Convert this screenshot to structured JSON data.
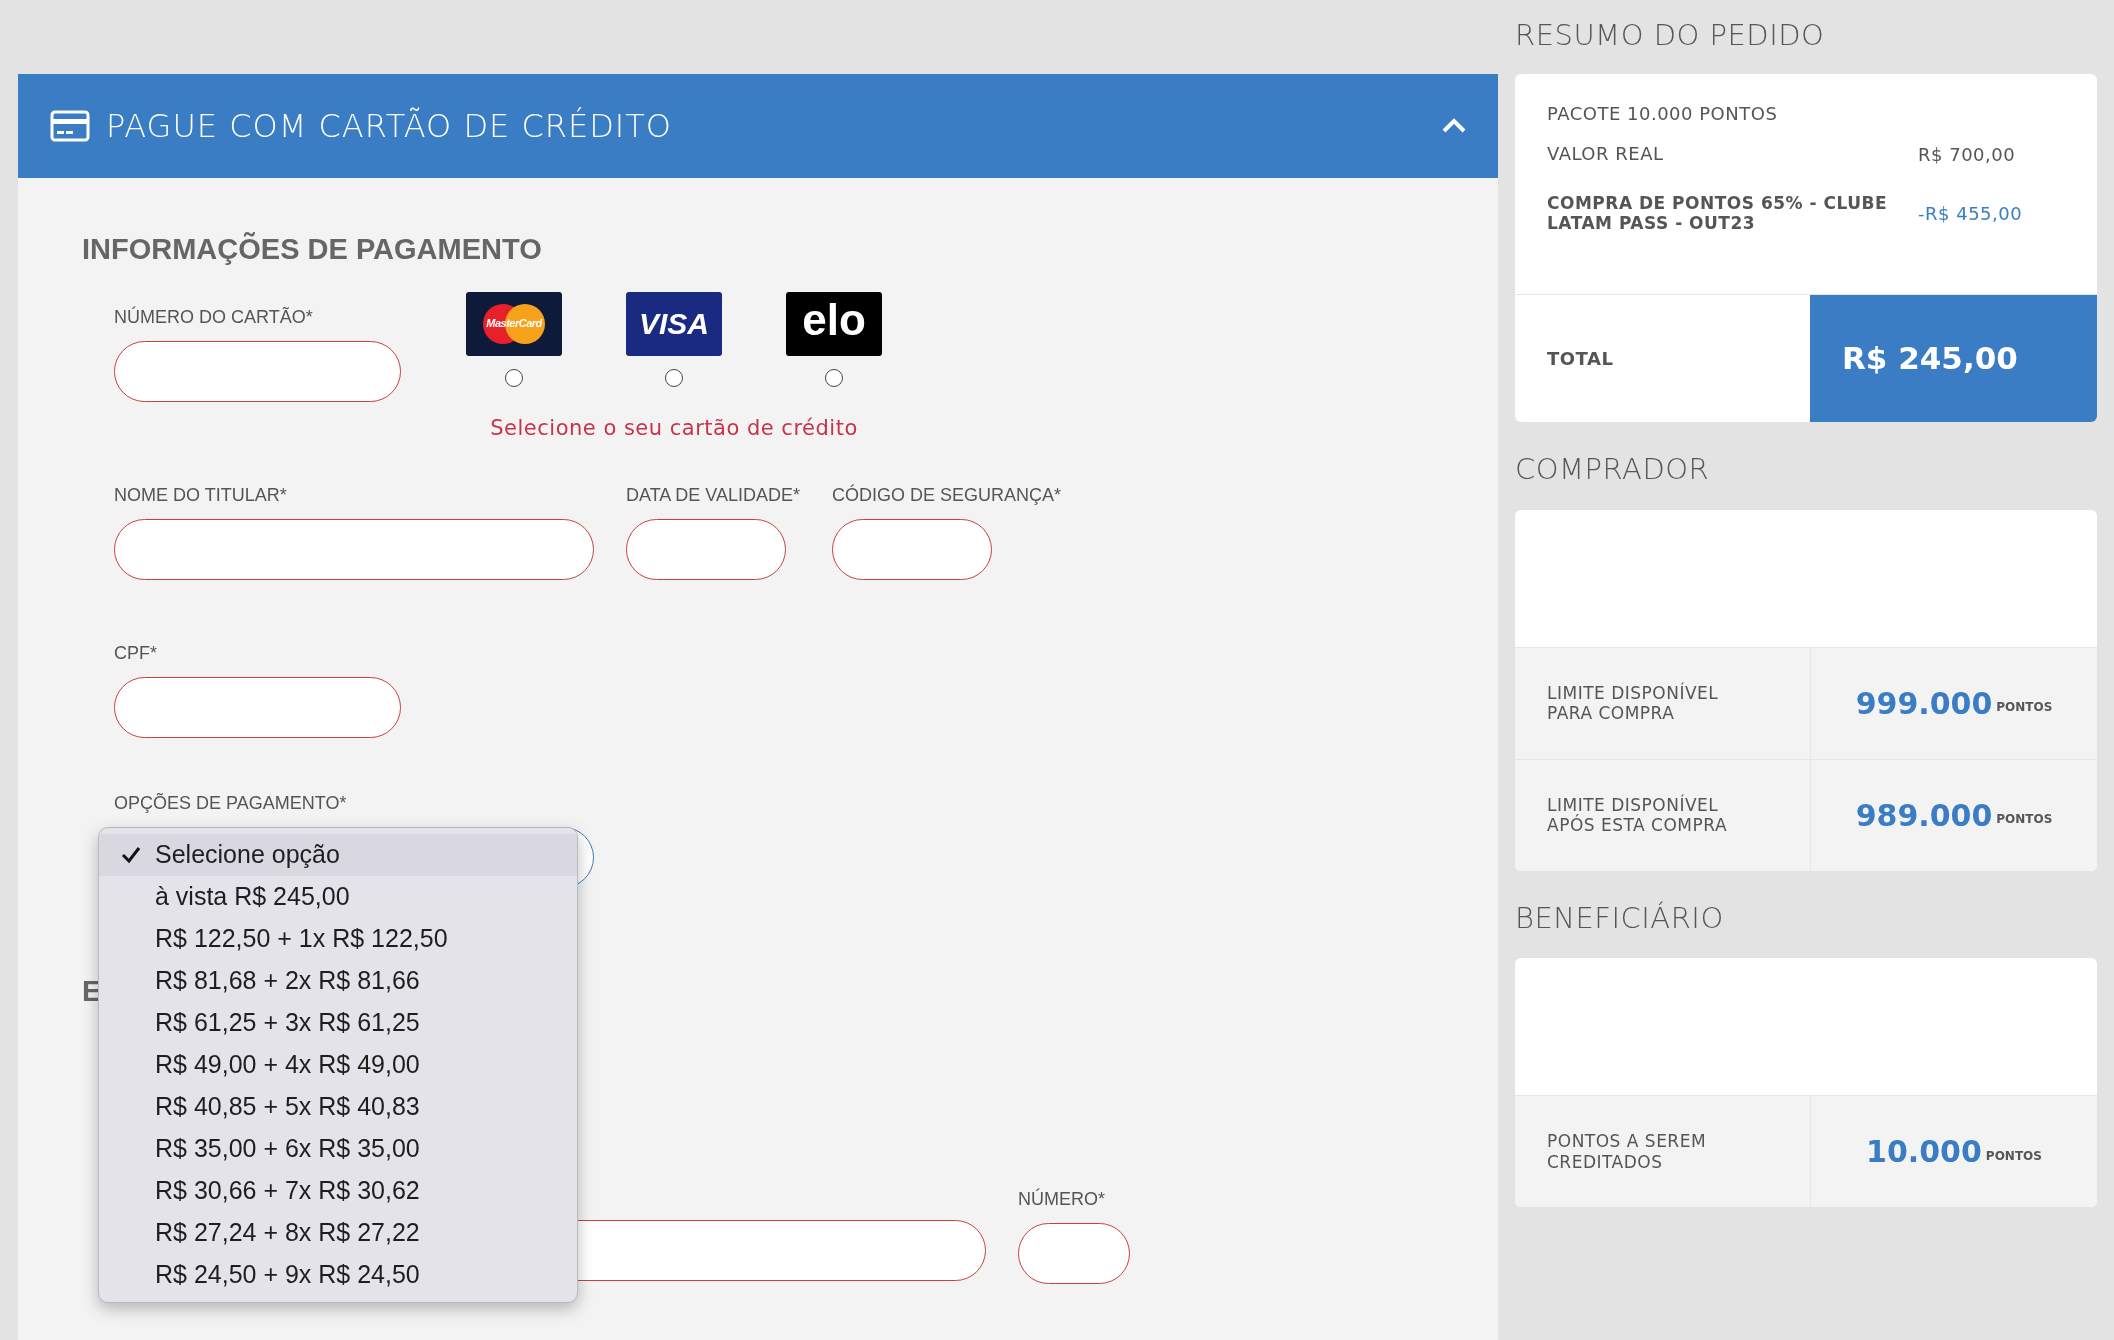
{
  "payment_panel": {
    "title": "PAGUE COM CARTÃO DE CRÉDITO",
    "expanded": true,
    "section_title": "INFORMAÇÕES DE PAGAMENTO",
    "card_number": {
      "label": "NÚMERO DO CARTÃO*"
    },
    "card_brands": [
      {
        "kind": "mastercard",
        "text": "MasterCard",
        "selected": false
      },
      {
        "kind": "visa",
        "text": "VISA",
        "selected": false
      },
      {
        "kind": "elo",
        "text": "elo",
        "selected": false
      }
    ],
    "brand_error": "Selecione o seu cartão de crédito",
    "holder_name": {
      "label": "NOME DO TITULAR*"
    },
    "expiry": {
      "label": "DATA DE VALIDADE*"
    },
    "security_code": {
      "label": "CÓDIGO DE SEGURANÇA*"
    },
    "cpf": {
      "label": "CPF*"
    },
    "payment_options": {
      "label": "OPÇÕES DE PAGAMENTO*",
      "expanded": true,
      "options": [
        {
          "text": "Selecione opção",
          "selected": true
        },
        {
          "text": "à vista R$ 245,00",
          "selected": false
        },
        {
          "text": "R$ 122,50 + 1x R$ 122,50",
          "selected": false
        },
        {
          "text": "R$ 81,68 + 2x R$ 81,66",
          "selected": false
        },
        {
          "text": "R$ 61,25 + 3x R$ 61,25",
          "selected": false
        },
        {
          "text": "R$ 49,00 + 4x R$ 49,00",
          "selected": false
        },
        {
          "text": "R$ 40,85 + 5x R$ 40,83",
          "selected": false
        },
        {
          "text": "R$ 35,00 + 6x R$ 35,00",
          "selected": false
        },
        {
          "text": "R$ 30,66 + 7x R$ 30,62",
          "selected": false
        },
        {
          "text": "R$ 27,24 + 8x R$ 27,22",
          "selected": false
        },
        {
          "text": "R$ 24,50 + 9x R$ 24,50",
          "selected": false
        }
      ]
    },
    "next_section_title": "E",
    "number_field": {
      "label": "NÚMERO*"
    }
  },
  "order_summary": {
    "title": "RESUMO DO PEDIDO",
    "package": "PACOTE 10.000 PONTOS",
    "lines": [
      {
        "kind": "price",
        "label": "VALOR REAL",
        "value": "R$ 700,00"
      },
      {
        "kind": "discount",
        "label": "COMPRA DE PONTOS 65% - CLUBE LATAM PASS - OUT23",
        "value": "-R$ 455,00"
      }
    ],
    "total_label": "TOTAL",
    "total_value": "R$ 245,00"
  },
  "buyer": {
    "title": "COMPRADOR",
    "stats": [
      {
        "label": "LIMITE DISPONÍVEL PARA COMPRA",
        "value": "999.000",
        "unit": "PONTOS"
      },
      {
        "label": "LIMITE DISPONÍVEL APÓS ESTA COMPRA",
        "value": "989.000",
        "unit": "PONTOS"
      }
    ]
  },
  "beneficiary": {
    "title": "BENEFICIÁRIO",
    "stats": [
      {
        "label": "PONTOS A SEREM CREDITADOS",
        "value": "10.000",
        "unit": "PONTOS"
      }
    ]
  }
}
